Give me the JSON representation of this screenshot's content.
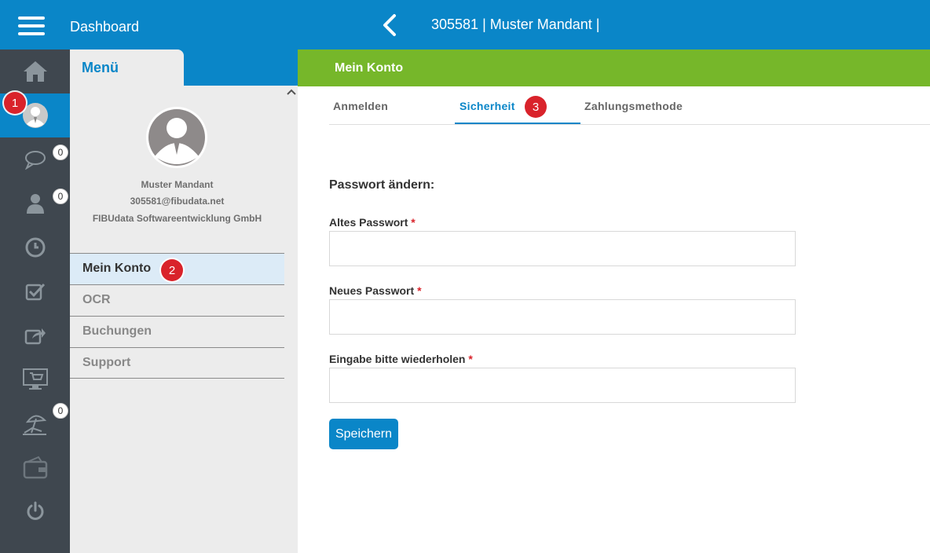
{
  "header": {
    "title": "Dashboard",
    "client": "305581 | Muster Mandant |"
  },
  "rail": {
    "badges": {
      "messages": "0",
      "contacts": "0",
      "vacation": "0"
    },
    "markers": {
      "profile": "1"
    }
  },
  "menu": {
    "tab_label": "Menü",
    "profile": {
      "name": "Muster Mandant",
      "email": "305581@fibudata.net",
      "company": "FIBUdata Softwareentwicklung GmbH"
    },
    "items": [
      {
        "label": "Mein Konto",
        "marker": "2"
      },
      {
        "label": "OCR"
      },
      {
        "label": "Buchungen"
      },
      {
        "label": "Support"
      }
    ]
  },
  "content": {
    "header": "Mein Konto",
    "tabs": [
      {
        "label": "Anmelden"
      },
      {
        "label": "Sicherheit",
        "marker": "3"
      },
      {
        "label": "Zahlungsmethode"
      }
    ],
    "section_title": "Passwort ändern:",
    "fields": [
      {
        "label": "Altes Passwort",
        "required": "*",
        "value": ""
      },
      {
        "label": "Neues Passwort",
        "required": "*",
        "value": ""
      },
      {
        "label": "Eingabe bitte wiederholen",
        "required": "*",
        "value": ""
      }
    ],
    "save_label": "Speichern"
  },
  "colors": {
    "primary": "#0a86c8",
    "green_header": "#76b72a",
    "rail": "#3f474f",
    "marker": "#d9232b"
  }
}
